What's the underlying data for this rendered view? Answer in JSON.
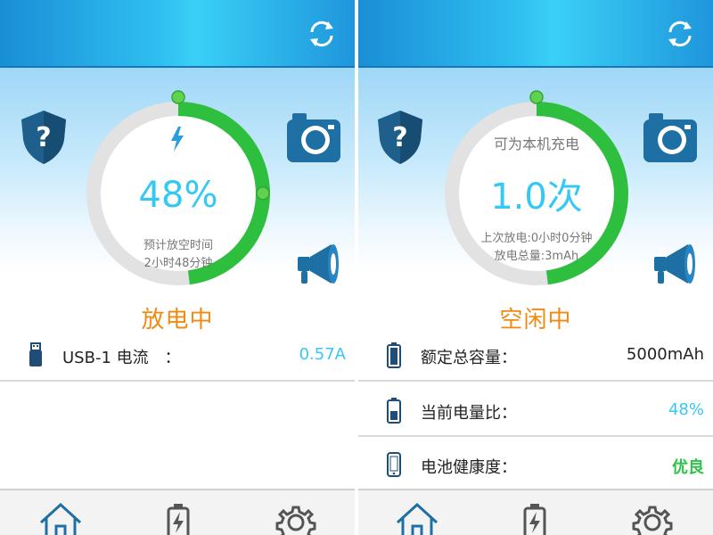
{
  "left": {
    "ring": {
      "icon": "lightning-bolt-icon",
      "percent": "48%",
      "estimate_label": "预计放空时间",
      "estimate_value": "2小时48分钟",
      "level": 48
    },
    "status": "放电中",
    "rows": [
      {
        "icon": "usb-icon",
        "label": "USB-1 电流　：",
        "value": "0.57A",
        "value_color": "#35c8f2"
      }
    ]
  },
  "right": {
    "ring": {
      "title": "可为本机充电",
      "count": "1.0次",
      "last_discharge": "上次放电:0小时0分钟",
      "discharge_total": "放电总量:3mAh",
      "level": 48
    },
    "status": "空闲中",
    "rows": [
      {
        "icon": "battery-full-icon",
        "label": "额定总容量：",
        "value": "5000mAh",
        "value_color": "#222222"
      },
      {
        "icon": "battery-half-icon",
        "label": "当前电量比：",
        "value": "48%",
        "value_color": "#35c8f2"
      },
      {
        "icon": "phone-icon",
        "label": "电池健康度：",
        "value": "优良",
        "value_color": "#2fc24a"
      }
    ]
  },
  "icons": [
    "refresh-icon",
    "help-shield-icon",
    "camera-icon",
    "megaphone-icon",
    "home-icon",
    "battery-charging-icon",
    "settings-gear-icon"
  ],
  "colors": {
    "accent_blue": "#35c8f2",
    "status_orange": "#f08a12",
    "ring_green": "#2fbf3f",
    "ring_gray": "#e2e2e2",
    "good_green": "#2fc24a"
  }
}
